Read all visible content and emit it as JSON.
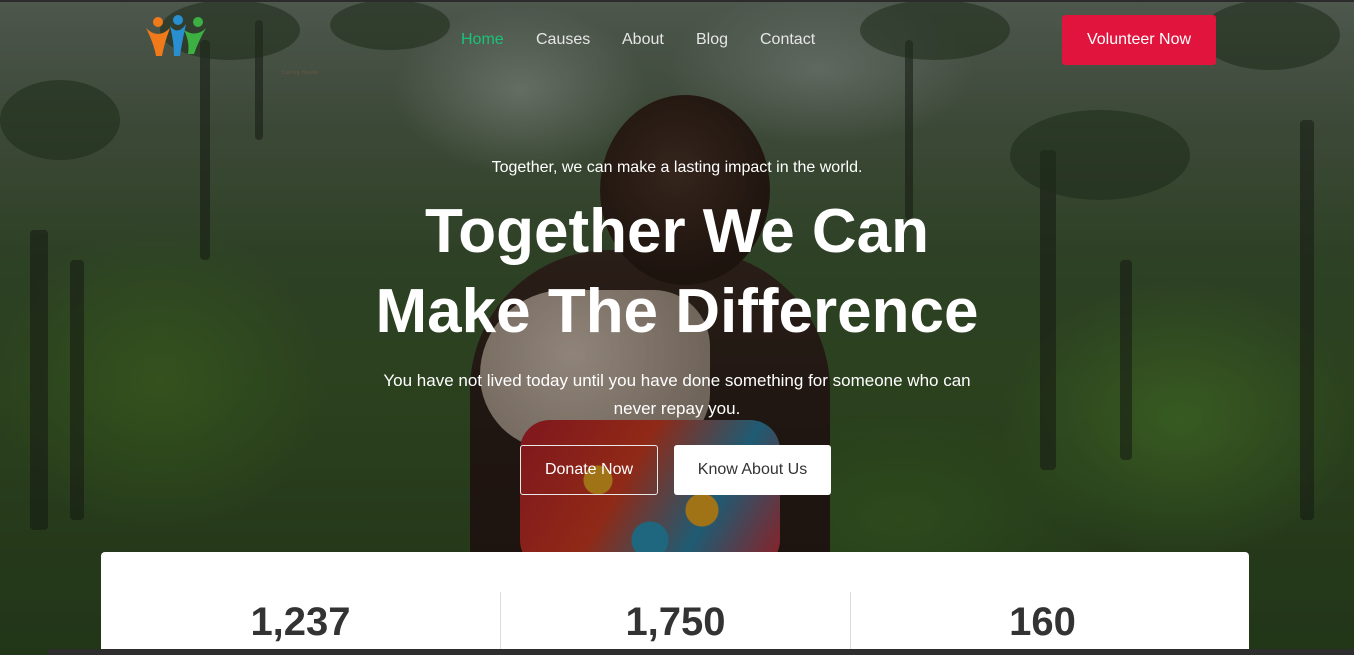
{
  "brand": {
    "logo_icon": "people-logo-icon",
    "caption": "Caring Hands",
    "colors": {
      "orange": "#f07a1a",
      "blue": "#2a8fd0",
      "green": "#3cb043"
    }
  },
  "nav": {
    "items": [
      {
        "label": "Home",
        "active": true
      },
      {
        "label": "Causes",
        "active": false
      },
      {
        "label": "About",
        "active": false
      },
      {
        "label": "Blog",
        "active": false
      },
      {
        "label": "Contact",
        "active": false
      }
    ],
    "active_color": "#19c37a"
  },
  "header": {
    "cta_label": "Volunteer Now",
    "cta_color": "#e0143c"
  },
  "hero": {
    "tagline": "Together, we can make a lasting impact in the world.",
    "headline_line1": "Together We Can",
    "headline_line2": "Make The Difference",
    "subtext": "You have not lived today until you have done something for someone who can never repay you.",
    "donate_label": "Donate Now",
    "about_label": "Know About Us"
  },
  "stats": [
    {
      "value": "1,237"
    },
    {
      "value": "1,750"
    },
    {
      "value": "160"
    }
  ]
}
